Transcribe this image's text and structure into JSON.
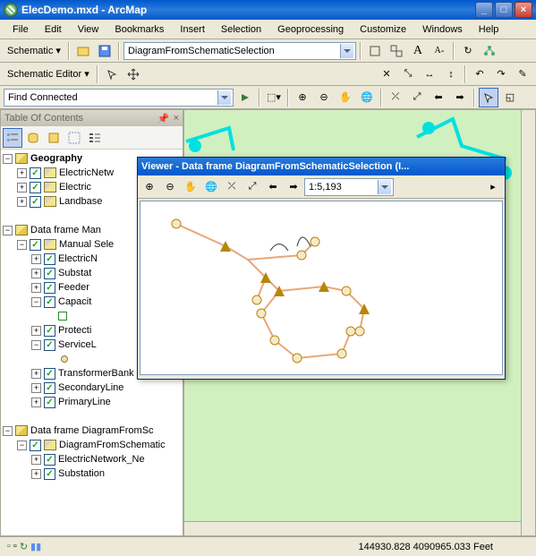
{
  "window": {
    "title": "ElecDemo.mxd - ArcMap",
    "min": "_",
    "max": "□",
    "close": "×"
  },
  "menu": [
    "File",
    "Edit",
    "View",
    "Bookmarks",
    "Insert",
    "Selection",
    "Geoprocessing",
    "Customize",
    "Windows",
    "Help"
  ],
  "tb1": {
    "schematic_label": "Schematic",
    "combo": "DiagramFromSchematicSelection"
  },
  "tb2": {
    "editor_label": "Schematic Editor"
  },
  "tb3": {
    "combo": "Find Connected"
  },
  "toc": {
    "title": "Table Of Contents",
    "rows": [
      {
        "indent": 0,
        "exp": "-",
        "chk": null,
        "icon": "df",
        "text": "Geography",
        "bold": true
      },
      {
        "indent": 1,
        "exp": "+",
        "chk": true,
        "icon": "layer",
        "text": "ElectricNetw"
      },
      {
        "indent": 1,
        "exp": "+",
        "chk": true,
        "icon": "layer",
        "text": "Electric"
      },
      {
        "indent": 1,
        "exp": "+",
        "chk": true,
        "icon": "layer",
        "text": "Landbase"
      },
      {
        "indent": 0,
        "exp": "",
        "chk": null,
        "icon": "",
        "text": ""
      },
      {
        "indent": 0,
        "exp": "-",
        "chk": null,
        "icon": "df",
        "text": "Data frame Man"
      },
      {
        "indent": 1,
        "exp": "-",
        "chk": true,
        "icon": "layer",
        "text": "Manual Sele"
      },
      {
        "indent": 2,
        "exp": "+",
        "chk": true,
        "icon": "",
        "text": "ElectricN"
      },
      {
        "indent": 2,
        "exp": "+",
        "chk": true,
        "icon": "",
        "text": "Substat"
      },
      {
        "indent": 2,
        "exp": "+",
        "chk": true,
        "icon": "",
        "text": "Feeder"
      },
      {
        "indent": 2,
        "exp": "-",
        "chk": true,
        "icon": "",
        "text": "Capacit"
      },
      {
        "indent": 3,
        "exp": "",
        "chk": null,
        "icon": "sq",
        "text": ""
      },
      {
        "indent": 2,
        "exp": "+",
        "chk": true,
        "icon": "",
        "text": "Protecti"
      },
      {
        "indent": 2,
        "exp": "-",
        "chk": true,
        "icon": "",
        "text": "ServiceL"
      },
      {
        "indent": 3,
        "exp": "",
        "chk": null,
        "icon": "circle",
        "text": ""
      },
      {
        "indent": 2,
        "exp": "+",
        "chk": true,
        "icon": "",
        "text": "TransformerBank"
      },
      {
        "indent": 2,
        "exp": "+",
        "chk": true,
        "icon": "",
        "text": "SecondaryLine"
      },
      {
        "indent": 2,
        "exp": "+",
        "chk": true,
        "icon": "",
        "text": "PrimaryLine"
      },
      {
        "indent": 0,
        "exp": "",
        "chk": null,
        "icon": "",
        "text": ""
      },
      {
        "indent": 0,
        "exp": "-",
        "chk": null,
        "icon": "df",
        "text": "Data frame DiagramFromSc"
      },
      {
        "indent": 1,
        "exp": "-",
        "chk": true,
        "icon": "layer",
        "text": "DiagramFromSchematic"
      },
      {
        "indent": 2,
        "exp": "+",
        "chk": true,
        "icon": "",
        "text": "ElectricNetwork_Ne"
      },
      {
        "indent": 2,
        "exp": "+",
        "chk": true,
        "icon": "",
        "text": "Substation"
      }
    ]
  },
  "viewer": {
    "title": "Viewer - Data frame DiagramFromSchematicSelection (I...",
    "scale": "1:5,193"
  },
  "status": {
    "left": "",
    "coords": "144930.828 4090965.033 Feet"
  },
  "icons": {
    "zoom_in": "⊕",
    "zoom_out": "⊖",
    "pan": "✋",
    "full": "🌐",
    "back": "⬅",
    "fwd": "➡",
    "arrows_in": "⤫",
    "arrows_out": "⤢"
  }
}
